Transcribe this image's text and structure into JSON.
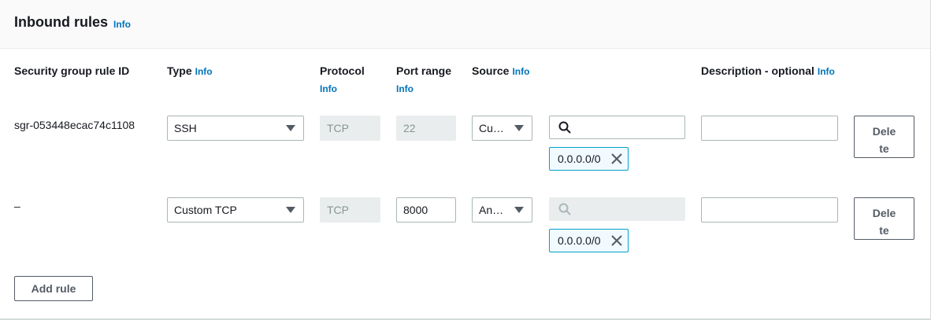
{
  "panel": {
    "title": "Inbound rules",
    "title_info": "Info"
  },
  "columns": {
    "rule_id": "Security group rule ID",
    "type": "Type",
    "type_info": "Info",
    "protocol": "Protocol",
    "protocol_info": "Info",
    "port_range": "Port range",
    "port_range_info": "Info",
    "source": "Source",
    "source_info": "Info",
    "description": "Description - optional",
    "description_info": "Info"
  },
  "rules": [
    {
      "rule_id": "sgr-053448ecac74c1108",
      "type": "SSH",
      "protocol": "TCP",
      "port_range": "22",
      "port_range_editable": false,
      "source_type": "Cu…",
      "search_value": "",
      "search_enabled": true,
      "cidr_token": "0.0.0.0/0",
      "description": "",
      "delete_label_line1": "Dele",
      "delete_label_line2": "te"
    },
    {
      "rule_id": "–",
      "type": "Custom TCP",
      "protocol": "TCP",
      "port_range": "8000",
      "port_range_editable": true,
      "source_type": "An…",
      "search_value": "",
      "search_enabled": false,
      "cidr_token": "0.0.0.0/0",
      "description": "",
      "delete_label_line1": "Dele",
      "delete_label_line2": "te"
    }
  ],
  "actions": {
    "add_rule": "Add rule"
  },
  "icons": {
    "search": "search-icon",
    "remove_token": "close-icon",
    "dropdown": "caret-down-icon"
  },
  "colors": {
    "link": "#0073bb",
    "token_border": "#00a1c9",
    "token_bg": "#f1faff",
    "disabled_bg": "#eaeded"
  }
}
